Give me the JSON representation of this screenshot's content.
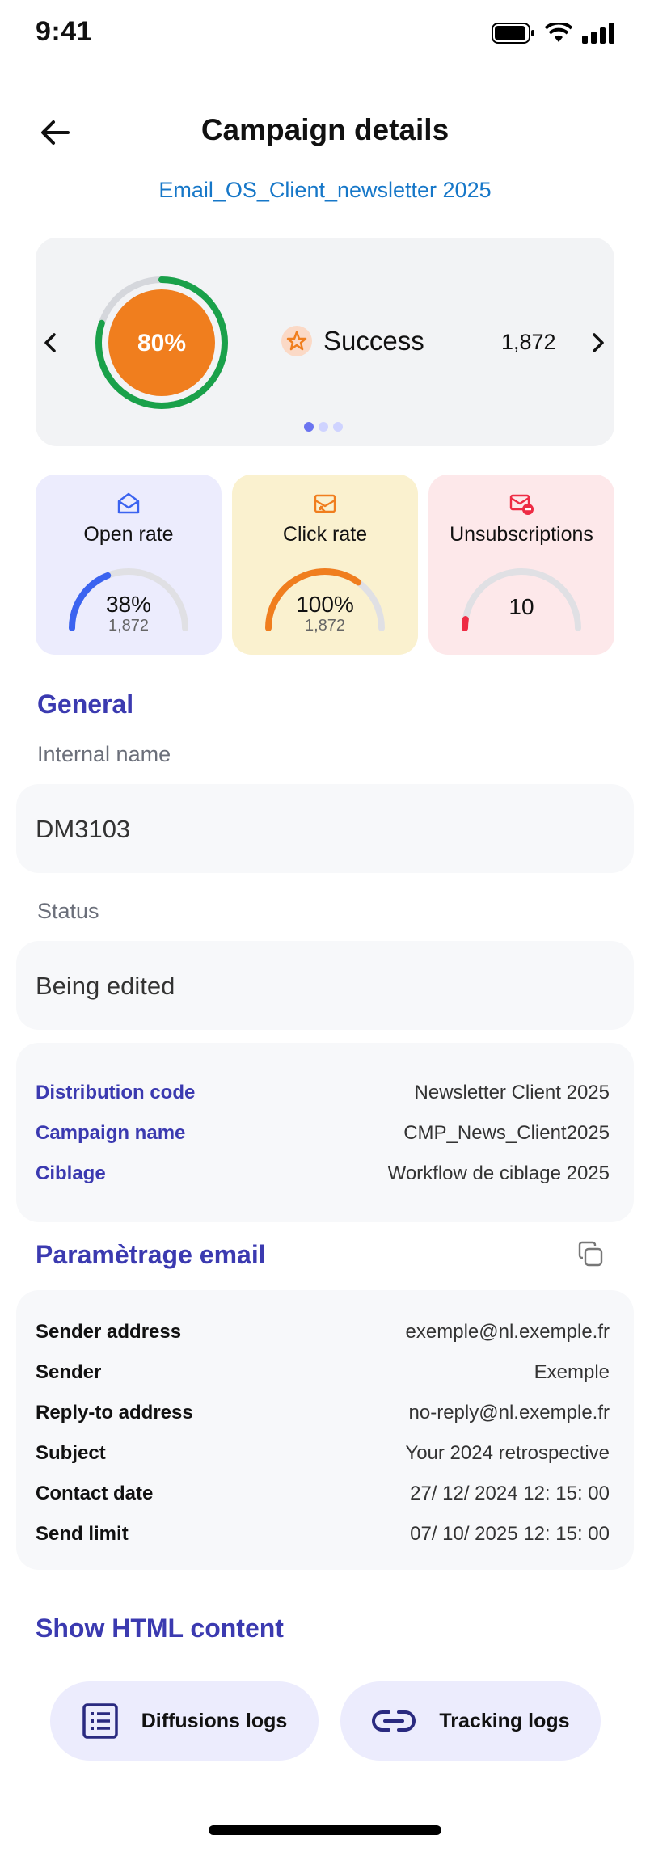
{
  "status_bar": {
    "time": "9:41"
  },
  "header": {
    "title": "Campaign details",
    "subtitle": "Email_OS_Client_newsletter 2025"
  },
  "hero": {
    "percent_label": "80%",
    "progress": 0.8,
    "status": "Success",
    "count": "1,872",
    "page": 1,
    "pages": 3
  },
  "stats": [
    {
      "label": "Open rate",
      "value": "38%",
      "sub": "1,872",
      "progress": 0.38,
      "color": "#3b63f0",
      "bg": "#ececfd"
    },
    {
      "label": "Click rate",
      "value": "100%",
      "sub": "1,872",
      "progress": 0.7,
      "color": "#f07e1e",
      "bg": "#faf1cf"
    },
    {
      "label": "Unsubscriptions",
      "value": "10",
      "progress": 0.05,
      "color": "#ee2b44",
      "bg": "#fde8ea"
    }
  ],
  "general": {
    "title": "General",
    "internal_name_label": "Internal name",
    "internal_name_value": "DM3103",
    "status_label": "Status",
    "status_value": "Being edited"
  },
  "details": [
    {
      "key": "Distribution code",
      "value": "Newsletter Client 2025"
    },
    {
      "key": "Campaign name",
      "value": "CMP_News_Client2025"
    },
    {
      "key": "Ciblage",
      "value": "Workflow de ciblage 2025"
    }
  ],
  "email_settings": {
    "title": "Paramètrage email",
    "rows": [
      {
        "key": "Sender address",
        "value": "exemple@nl.exemple.fr"
      },
      {
        "key": "Sender",
        "value": "Exemple"
      },
      {
        "key": "Reply-to address",
        "value": "no-reply@nl.exemple.fr"
      },
      {
        "key": "Subject",
        "value": "Your 2024 retrospective"
      },
      {
        "key": "Contact date",
        "value": "27/ 12/ 2024  12: 15: 00"
      },
      {
        "key": "Send limit",
        "value": "07/ 10/ 2025  12: 15: 00"
      }
    ]
  },
  "show_html": "Show HTML content",
  "buttons": {
    "diffusion": "Diffusions logs",
    "tracking": "Tracking logs"
  },
  "colors": {
    "accent": "#3b3ab0",
    "link": "#1677c8",
    "ring": "#1aa14a",
    "orange": "#f07e1e"
  }
}
